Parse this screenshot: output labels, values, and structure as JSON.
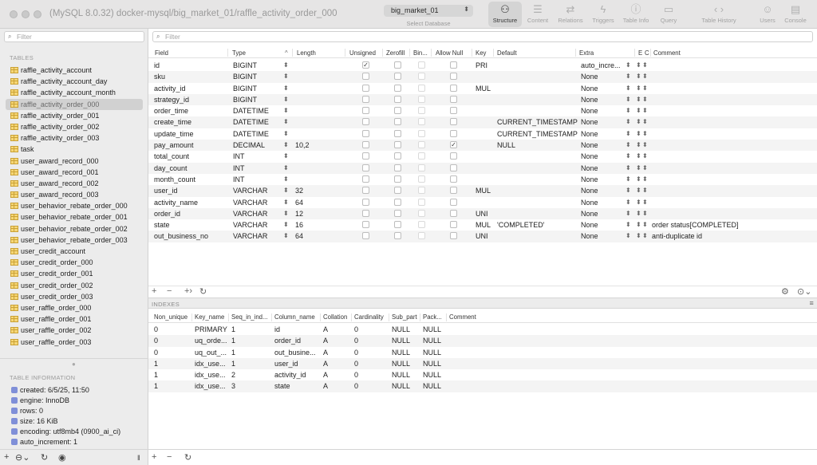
{
  "window": {
    "title": "(MySQL 8.0.32) docker-mysql/big_market_01/raffle_activity_order_000",
    "database": "big_market_01",
    "database_caption": "Select Database"
  },
  "toolbar": {
    "items": [
      {
        "label": "Structure",
        "icon": "structure-icon",
        "glyph": "⚇",
        "active": true
      },
      {
        "label": "Content",
        "icon": "list-icon",
        "glyph": "☰",
        "active": false
      },
      {
        "label": "Relations",
        "icon": "relations-icon",
        "glyph": "⇄",
        "active": false
      },
      {
        "label": "Triggers",
        "icon": "bolt-icon",
        "glyph": "ϟ",
        "active": false
      },
      {
        "label": "Table Info",
        "icon": "info-icon",
        "glyph": "ⓘ",
        "active": false
      },
      {
        "label": "Query",
        "icon": "terminal-icon",
        "glyph": "▭",
        "active": false
      },
      {
        "label": "Table History",
        "icon": "history-arrows-icon",
        "glyph": "‹ ›",
        "active": false
      },
      {
        "label": "Users",
        "icon": "users-icon",
        "glyph": "☺",
        "active": false
      },
      {
        "label": "Console",
        "icon": "console-icon",
        "glyph": "▤",
        "active": false
      }
    ]
  },
  "sidebar": {
    "filter_placeholder": "Filter",
    "tables_header": "TABLES",
    "tables": [
      "raffle_activity_account",
      "raffle_activity_account_day",
      "raffle_activity_account_month",
      "raffle_activity_order_000",
      "raffle_activity_order_001",
      "raffle_activity_order_002",
      "raffle_activity_order_003",
      "task",
      "user_award_record_000",
      "user_award_record_001",
      "user_award_record_002",
      "user_award_record_003",
      "user_behavior_rebate_order_000",
      "user_behavior_rebate_order_001",
      "user_behavior_rebate_order_002",
      "user_behavior_rebate_order_003",
      "user_credit_account",
      "user_credit_order_000",
      "user_credit_order_001",
      "user_credit_order_002",
      "user_credit_order_003",
      "user_raffle_order_000",
      "user_raffle_order_001",
      "user_raffle_order_002",
      "user_raffle_order_003"
    ],
    "selected_index": 3,
    "info_header": "TABLE INFORMATION",
    "info": [
      "created: 6/5/25, 11:50",
      "engine: InnoDB",
      "rows: 0",
      "size: 16 KiB",
      "encoding: utf8mb4 (0900_ai_ci)",
      "auto_increment: 1"
    ]
  },
  "structure": {
    "filter_placeholder": "Filter",
    "headers": {
      "field": "Field",
      "type": "Type",
      "length": "Length",
      "unsigned": "Unsigned",
      "zerofill": "Zerofill",
      "binary": "Bin...",
      "allow_null": "Allow Null",
      "key": "Key",
      "default": "Default",
      "extra": "Extra",
      "enc": "E",
      "coll": "C",
      "comment": "Comment"
    },
    "rows": [
      {
        "field": "id",
        "type": "BIGINT",
        "length": "",
        "unsigned": true,
        "allow_null": false,
        "key": "PRI",
        "default": "",
        "extra": "auto_incre...",
        "comment": ""
      },
      {
        "field": "sku",
        "type": "BIGINT",
        "length": "",
        "unsigned": false,
        "allow_null": false,
        "key": "",
        "default": "",
        "extra": "None",
        "comment": ""
      },
      {
        "field": "activity_id",
        "type": "BIGINT",
        "length": "",
        "unsigned": false,
        "allow_null": false,
        "key": "MUL",
        "default": "",
        "extra": "None",
        "comment": ""
      },
      {
        "field": "strategy_id",
        "type": "BIGINT",
        "length": "",
        "unsigned": false,
        "allow_null": false,
        "key": "",
        "default": "",
        "extra": "None",
        "comment": ""
      },
      {
        "field": "order_time",
        "type": "DATETIME",
        "length": "",
        "unsigned": false,
        "allow_null": false,
        "key": "",
        "default": "",
        "extra": "None",
        "comment": ""
      },
      {
        "field": "create_time",
        "type": "DATETIME",
        "length": "",
        "unsigned": false,
        "allow_null": false,
        "key": "",
        "default": "CURRENT_TIMESTAMP",
        "extra": "None",
        "comment": ""
      },
      {
        "field": "update_time",
        "type": "DATETIME",
        "length": "",
        "unsigned": false,
        "allow_null": false,
        "key": "",
        "default": "CURRENT_TIMESTAMP",
        "extra": "None",
        "comment": ""
      },
      {
        "field": "pay_amount",
        "type": "DECIMAL",
        "length": "10,2",
        "unsigned": false,
        "allow_null": true,
        "key": "",
        "default": "NULL",
        "extra": "None",
        "comment": ""
      },
      {
        "field": "total_count",
        "type": "INT",
        "length": "",
        "unsigned": false,
        "allow_null": false,
        "key": "",
        "default": "",
        "extra": "None",
        "comment": ""
      },
      {
        "field": "day_count",
        "type": "INT",
        "length": "",
        "unsigned": false,
        "allow_null": false,
        "key": "",
        "default": "",
        "extra": "None",
        "comment": ""
      },
      {
        "field": "month_count",
        "type": "INT",
        "length": "",
        "unsigned": false,
        "allow_null": false,
        "key": "",
        "default": "",
        "extra": "None",
        "comment": ""
      },
      {
        "field": "user_id",
        "type": "VARCHAR",
        "length": "32",
        "unsigned": false,
        "allow_null": false,
        "key": "MUL",
        "default": "",
        "extra": "None",
        "comment": ""
      },
      {
        "field": "activity_name",
        "type": "VARCHAR",
        "length": "64",
        "unsigned": false,
        "allow_null": false,
        "key": "",
        "default": "",
        "extra": "None",
        "comment": ""
      },
      {
        "field": "order_id",
        "type": "VARCHAR",
        "length": "12",
        "unsigned": false,
        "allow_null": false,
        "key": "UNI",
        "default": "",
        "extra": "None",
        "comment": ""
      },
      {
        "field": "state",
        "type": "VARCHAR",
        "length": "16",
        "unsigned": false,
        "allow_null": false,
        "key": "MUL",
        "default": "'COMPLETED'",
        "extra": "None",
        "comment": "order status[COMPLETED]"
      },
      {
        "field": "out_business_no",
        "type": "VARCHAR",
        "length": "64",
        "unsigned": false,
        "allow_null": false,
        "key": "UNI",
        "default": "",
        "extra": "None",
        "comment": "anti-duplicate id"
      }
    ]
  },
  "indexes": {
    "section_header": "INDEXES",
    "headers": [
      "Non_unique",
      "Key_name",
      "Seq_in_ind...",
      "Column_name",
      "Collation",
      "Cardinality",
      "Sub_part",
      "Pack...",
      "Comment"
    ],
    "rows": [
      [
        "0",
        "PRIMARY",
        "1",
        "id",
        "A",
        "0",
        "NULL",
        "NULL",
        ""
      ],
      [
        "0",
        "uq_orde...",
        "1",
        "order_id",
        "A",
        "0",
        "NULL",
        "NULL",
        ""
      ],
      [
        "0",
        "uq_out_...",
        "1",
        "out_busine...",
        "A",
        "0",
        "NULL",
        "NULL",
        ""
      ],
      [
        "1",
        "idx_use...",
        "1",
        "user_id",
        "A",
        "0",
        "NULL",
        "NULL",
        ""
      ],
      [
        "1",
        "idx_use...",
        "2",
        "activity_id",
        "A",
        "0",
        "NULL",
        "NULL",
        ""
      ],
      [
        "1",
        "idx_use...",
        "3",
        "state",
        "A",
        "0",
        "NULL",
        "NULL",
        ""
      ]
    ]
  }
}
